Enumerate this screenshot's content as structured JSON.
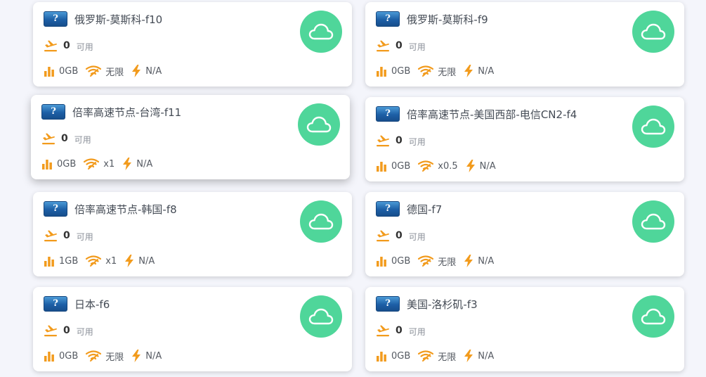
{
  "labels": {
    "available": "可用"
  },
  "colors": {
    "accent": "#f29b1d",
    "cloud": "#4fd69a",
    "flag": "#1d5fa6"
  },
  "icons": {
    "flag": "unknown-flag-icon",
    "flight": "flight-departure-icon",
    "traffic": "bar-chart-icon",
    "rate": "signal-icon",
    "speed": "lightning-icon",
    "status": "cloud-icon"
  },
  "nodes": [
    {
      "flag": "?",
      "name": "俄罗斯-莫斯科-f10",
      "online": "0",
      "traffic": "0GB",
      "rate": "无限",
      "speed": "N/A"
    },
    {
      "flag": "?",
      "name": "俄罗斯-莫斯科-f9",
      "online": "0",
      "traffic": "0GB",
      "rate": "无限",
      "speed": "N/A"
    },
    {
      "flag": "?",
      "name": "倍率高速节点-台湾-f11",
      "online": "0",
      "traffic": "0GB",
      "rate": "x1",
      "speed": "N/A"
    },
    {
      "flag": "?",
      "name": "倍率高速节点-美国西部-电信CN2-f4",
      "online": "0",
      "traffic": "0GB",
      "rate": "x0.5",
      "speed": "N/A"
    },
    {
      "flag": "?",
      "name": "倍率高速节点-韩国-f8",
      "online": "0",
      "traffic": "1GB",
      "rate": "x1",
      "speed": "N/A"
    },
    {
      "flag": "?",
      "name": "德国-f7",
      "online": "0",
      "traffic": "0GB",
      "rate": "无限",
      "speed": "N/A"
    },
    {
      "flag": "?",
      "name": "日本-f6",
      "online": "0",
      "traffic": "0GB",
      "rate": "无限",
      "speed": "N/A"
    },
    {
      "flag": "?",
      "name": "美国-洛杉矶-f3",
      "online": "0",
      "traffic": "0GB",
      "rate": "无限",
      "speed": "N/A"
    }
  ]
}
